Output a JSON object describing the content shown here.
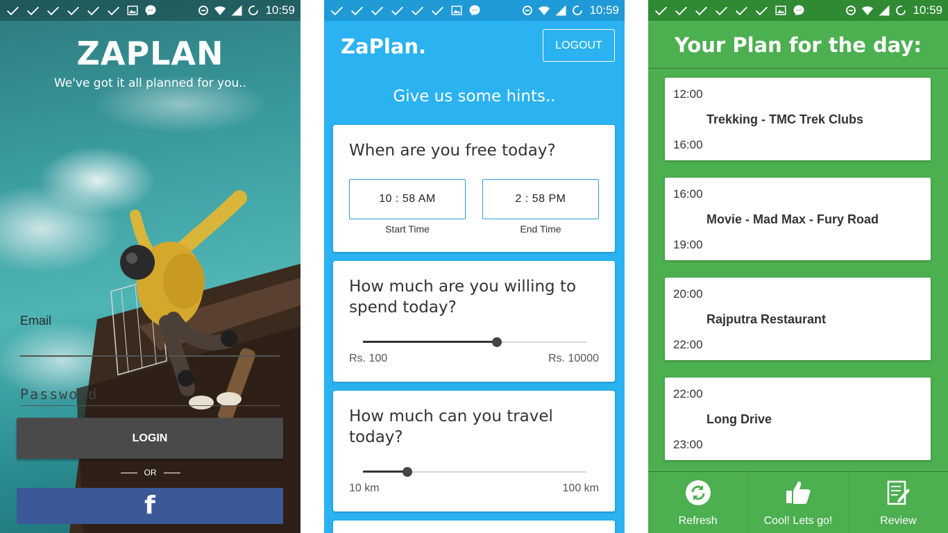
{
  "status_bar": {
    "time": "10:59"
  },
  "login": {
    "logo": "ZAPLAN",
    "tagline": "We've got it all planned for you..",
    "email_label": "Email",
    "password_placeholder": "Password",
    "login_button": "LOGIN",
    "or_text": "OR",
    "facebook_icon": "facebook-icon"
  },
  "hints": {
    "app_title": "ZaPlan.",
    "logout_button": "LOGOUT",
    "heading": "Give us some hints..",
    "free_time": {
      "question": "When are you free today?",
      "start_value": "10 : 58  AM",
      "start_label": "Start Time",
      "end_value": "2 : 58  PM",
      "end_label": "End Time"
    },
    "budget": {
      "question": "How much are you willing to spend today?",
      "min_label": "Rs. 100",
      "max_label": "Rs. 10000",
      "fraction": 0.6
    },
    "travel": {
      "question": "How much can you travel today?",
      "min_label": "10 km",
      "max_label": "100 km",
      "fraction": 0.2
    }
  },
  "plan": {
    "title": "Your Plan for the day:",
    "items": [
      {
        "start": "12:00",
        "title": "Trekking - TMC Trek Clubs",
        "end": "16:00"
      },
      {
        "start": "16:00",
        "title": "Movie - Mad Max - Fury Road",
        "end": "19:00"
      },
      {
        "start": "20:00",
        "title": "Rajputra Restaurant",
        "end": "22:00"
      },
      {
        "start": "22:00",
        "title": "Long Drive",
        "end": "23:00"
      }
    ],
    "actions": [
      {
        "label": "Refresh",
        "icon": "refresh-icon"
      },
      {
        "label": "Cool! Lets go!",
        "icon": "thumbs-up-icon"
      },
      {
        "label": "Review",
        "icon": "review-icon"
      }
    ]
  },
  "colors": {
    "login_button": "#4a4a4a",
    "facebook": "#3b5998",
    "hints_bg": "#2ab2f1",
    "plan_bg": "#4caf50"
  }
}
